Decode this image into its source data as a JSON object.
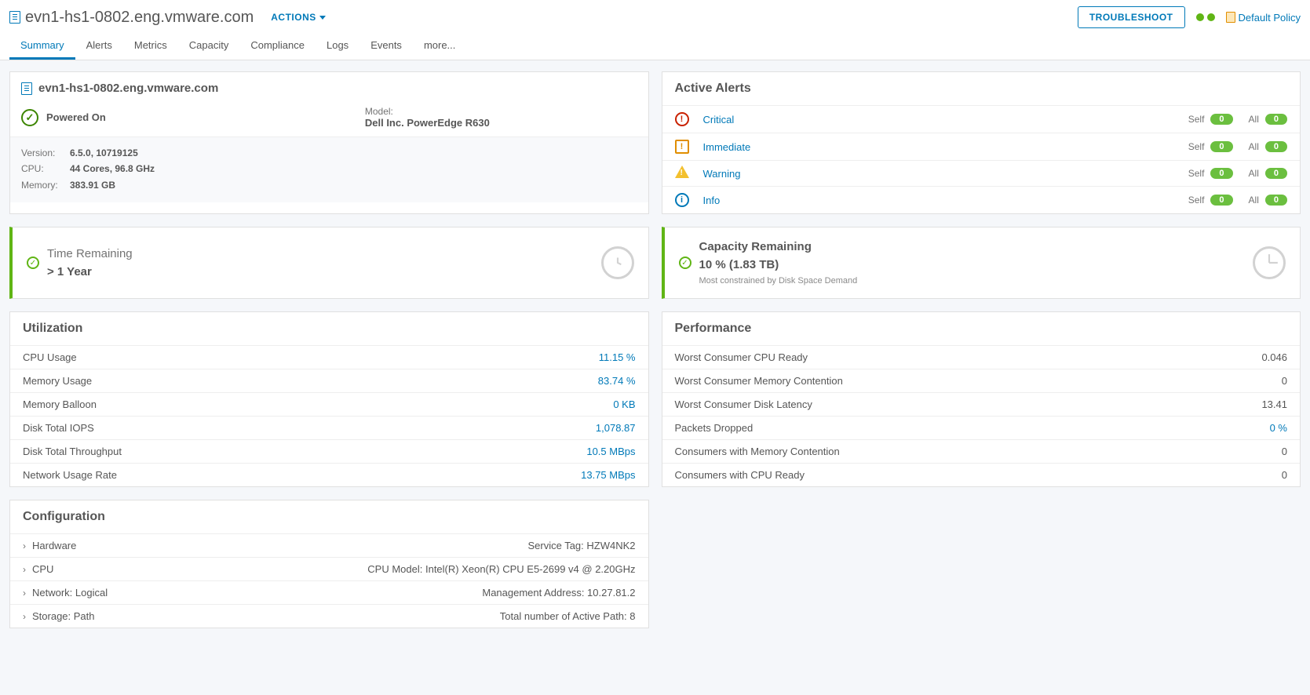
{
  "header": {
    "hostname": "evn1-hs1-0802.eng.vmware.com",
    "actions_label": "ACTIONS",
    "troubleshoot_label": "TROUBLESHOOT",
    "policy_label": "Default Policy"
  },
  "tabs": [
    "Summary",
    "Alerts",
    "Metrics",
    "Capacity",
    "Compliance",
    "Logs",
    "Events",
    "more..."
  ],
  "summary": {
    "hostname": "evn1-hs1-0802.eng.vmware.com",
    "power": "Powered On",
    "model_label": "Model:",
    "model_value": "Dell Inc. PowerEdge R630",
    "specs": [
      {
        "label": "Version:",
        "value": "6.5.0, 10719125"
      },
      {
        "label": "CPU:",
        "value": "44 Cores, 96.8 GHz"
      },
      {
        "label": "Memory:",
        "value": "383.91 GB"
      }
    ]
  },
  "alerts": {
    "title": "Active Alerts",
    "rows": [
      {
        "label": "Critical",
        "self": "0",
        "all": "0"
      },
      {
        "label": "Immediate",
        "self": "0",
        "all": "0"
      },
      {
        "label": "Warning",
        "self": "0",
        "all": "0"
      },
      {
        "label": "Info",
        "self": "0",
        "all": "0"
      }
    ],
    "self_label": "Self",
    "all_label": "All"
  },
  "time_remaining": {
    "title": "Time Remaining",
    "value": "> 1 Year"
  },
  "capacity": {
    "title": "Capacity Remaining",
    "value": "10 % (1.83 TB)",
    "sub": "Most constrained by Disk Space Demand"
  },
  "utilization": {
    "title": "Utilization",
    "rows": [
      {
        "label": "CPU Usage",
        "value": "11.15 %"
      },
      {
        "label": "Memory Usage",
        "value": "83.74 %"
      },
      {
        "label": "Memory Balloon",
        "value": "0 KB"
      },
      {
        "label": "Disk Total IOPS",
        "value": "1,078.87"
      },
      {
        "label": "Disk Total Throughput",
        "value": "10.5 MBps"
      },
      {
        "label": "Network Usage Rate",
        "value": "13.75 MBps"
      }
    ]
  },
  "performance": {
    "title": "Performance",
    "rows": [
      {
        "label": "Worst Consumer CPU Ready",
        "value": "0.046",
        "link": false
      },
      {
        "label": "Worst Consumer Memory Contention",
        "value": "0",
        "link": false
      },
      {
        "label": "Worst Consumer Disk Latency",
        "value": "13.41",
        "link": false
      },
      {
        "label": "Packets Dropped",
        "value": "0 %",
        "link": true
      },
      {
        "label": "Consumers with Memory Contention",
        "value": "0",
        "link": false
      },
      {
        "label": "Consumers with CPU Ready",
        "value": "0",
        "link": false
      }
    ]
  },
  "configuration": {
    "title": "Configuration",
    "rows": [
      {
        "label": "Hardware",
        "value": "Service Tag: HZW4NK2"
      },
      {
        "label": "CPU",
        "value": "CPU Model: Intel(R) Xeon(R) CPU E5-2699 v4 @ 2.20GHz"
      },
      {
        "label": "Network: Logical",
        "value": "Management Address: 10.27.81.2"
      },
      {
        "label": "Storage: Path",
        "value": "Total number of Active Path: 8"
      }
    ]
  }
}
